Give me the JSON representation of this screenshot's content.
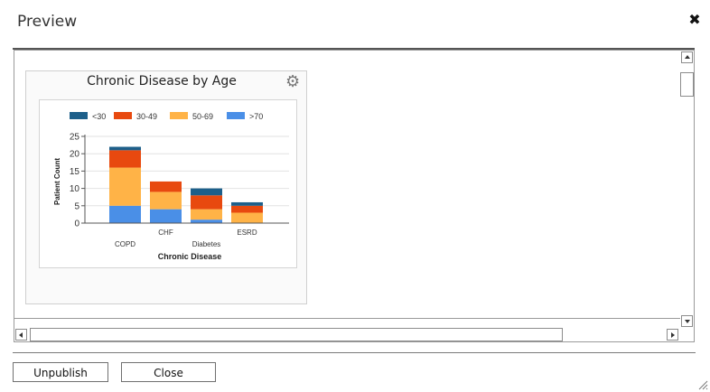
{
  "dialog": {
    "title": "Preview",
    "close_icon": "close-icon"
  },
  "widget": {
    "title": "Chronic Disease by Age",
    "settings_icon": "gear-icon"
  },
  "chart_data": {
    "type": "bar",
    "stacked": true,
    "categories": [
      "COPD",
      "CHF",
      "Diabetes",
      "ESRD"
    ],
    "series": [
      {
        "name": "<30",
        "color": "#1d5f8a",
        "values": [
          1,
          0,
          2,
          1
        ]
      },
      {
        "name": "30-49",
        "color": "#e8490f",
        "values": [
          5,
          3,
          4,
          2
        ]
      },
      {
        "name": "50-69",
        "color": "#ffb347",
        "values": [
          11,
          5,
          3,
          3
        ]
      },
      {
        "name": ">70",
        "color": "#4a8fe7",
        "values": [
          5,
          4,
          1,
          0
        ]
      }
    ],
    "title": "",
    "xlabel": "Chronic Disease",
    "ylabel": "Patient Count",
    "ylim": [
      0,
      25
    ],
    "yticks": [
      0,
      5,
      10,
      15,
      20,
      25
    ],
    "grid": true,
    "legend": "top"
  },
  "footer": {
    "unpublish_label": "Unpublish",
    "close_label": "Close"
  }
}
